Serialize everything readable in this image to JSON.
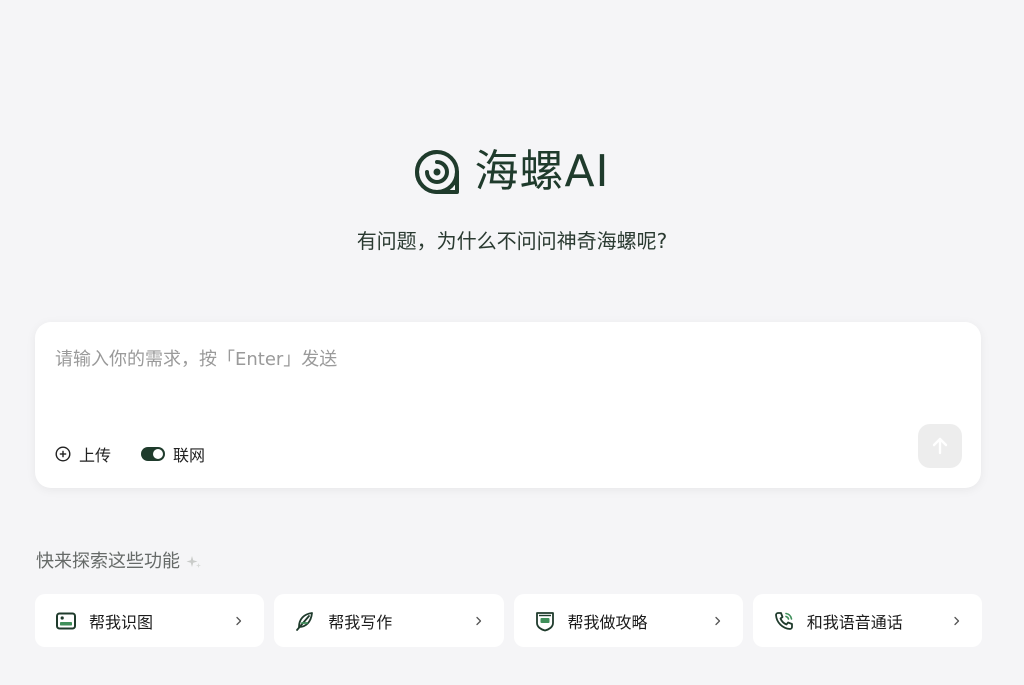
{
  "brand": {
    "name": "海螺AI",
    "logo_icon": "snail-logo-icon",
    "color": "#1f3b2c"
  },
  "tagline": "有问题，为什么不问问神奇海螺呢?",
  "input": {
    "placeholder": "请输入你的需求，按「Enter」发送",
    "value": ""
  },
  "tools": {
    "upload_label": "上传",
    "upload_icon": "plus-circle-icon",
    "web_label": "联网",
    "web_toggle_on": true
  },
  "send_icon": "arrow-up-icon",
  "explore": {
    "title": "快来探索这些功能",
    "icon": "sparkle-icon"
  },
  "features": [
    {
      "label": "帮我识图",
      "icon": "image-icon"
    },
    {
      "label": "帮我写作",
      "icon": "feather-icon"
    },
    {
      "label": "帮我做攻略",
      "icon": "guide-badge-icon"
    },
    {
      "label": "和我语音通话",
      "icon": "phone-icon"
    }
  ],
  "colors": {
    "background": "#f5f5f7",
    "accent": "#1f3b2c",
    "card": "#ffffff"
  }
}
